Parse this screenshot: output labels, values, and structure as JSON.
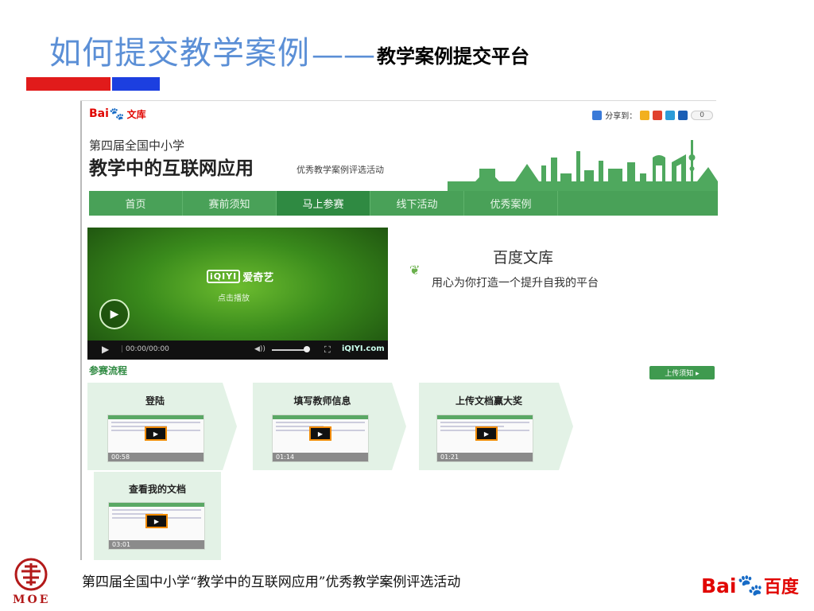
{
  "slide": {
    "title_main": "如何提交教学案例",
    "title_dash": "——",
    "title_sub": "教学案例提交平台",
    "footer_text": "第四届全国中小学“教学中的互联网应用”优秀教学案例评选活动",
    "moe_text": "MOE",
    "baidu_logo": {
      "part1": "Bai",
      "paw": "du",
      "part2": "百度"
    }
  },
  "colors": {
    "title_blue": "#5b8fd6",
    "nav_green": "#49a158",
    "nav_active": "#2f8a42",
    "bar_red": "#e11b1b",
    "bar_blue": "#1c3fe0"
  },
  "site": {
    "logo": {
      "part1": "Bai",
      "paw": "du",
      "part2": "文库"
    },
    "share": {
      "label": "分享到：",
      "count": "0",
      "icons": [
        "qzone-icon",
        "weibo-icon",
        "tencent-icon",
        "renren-icon"
      ]
    },
    "headline_small": "第四届全国中小学",
    "headline_big": "教学中的互联网应用",
    "headline_sub": "优秀教学案例评选活动",
    "nav": [
      "首页",
      "赛前须知",
      "马上参赛",
      "线下活动",
      "优秀案例"
    ],
    "nav_active_index": 2
  },
  "video": {
    "brand_box": "iQIYI",
    "brand_text": "爱奇艺",
    "click_play": "点击播放",
    "time": "00:00/00:00",
    "watermark": "iQIYI.com"
  },
  "wenku": {
    "title": "百度文库",
    "slogan": "用心为你打造一个提升自我的平台"
  },
  "process": {
    "label": "参赛流程",
    "upload_button": "上传须知 ▸",
    "steps": [
      {
        "label": "登陆",
        "duration": "00:58"
      },
      {
        "label": "填写教师信息",
        "duration": "01:14"
      },
      {
        "label": "上传文档赢大奖",
        "duration": "01:21"
      },
      {
        "label": "查看我的文档",
        "duration": "03:01"
      }
    ]
  }
}
